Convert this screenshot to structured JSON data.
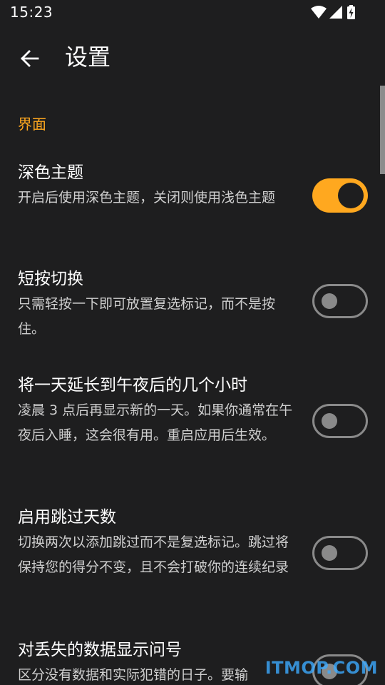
{
  "status_bar": {
    "time": "15:23",
    "icons": [
      "wifi-icon",
      "signal-icon",
      "battery-charging-icon"
    ]
  },
  "app_bar": {
    "back_icon": "arrow-left-icon",
    "title": "设置"
  },
  "section": {
    "header": "界面"
  },
  "settings": [
    {
      "title": "深色主题",
      "description": "开启后使用深色主题，关闭则使用浅色主题",
      "enabled": true
    },
    {
      "title": "短按切换",
      "description": "只需轻按一下即可放置复选标记，而不是按住。",
      "enabled": false
    },
    {
      "title": "将一天延长到午夜后的几个小时",
      "description": "凌晨 3 点后再显示新的一天。如果你通常在午夜后入睡，这会很有用。重启应用后生效。",
      "enabled": false
    },
    {
      "title": "启用跳过天数",
      "description": "切换两次以添加跳过而不是复选标记。跳过将保持您的得分不变，且不会打破你的连续纪录",
      "enabled": false
    },
    {
      "title": "对丢失的数据显示问号",
      "description": "区分没有数据和实际犯错的日子。要输",
      "enabled": false
    }
  ],
  "watermark": "ITMOP.COM",
  "colors": {
    "background": "#1e1e1f",
    "accent": "#ffa81f",
    "toggle_off": "#8a8a8a"
  }
}
